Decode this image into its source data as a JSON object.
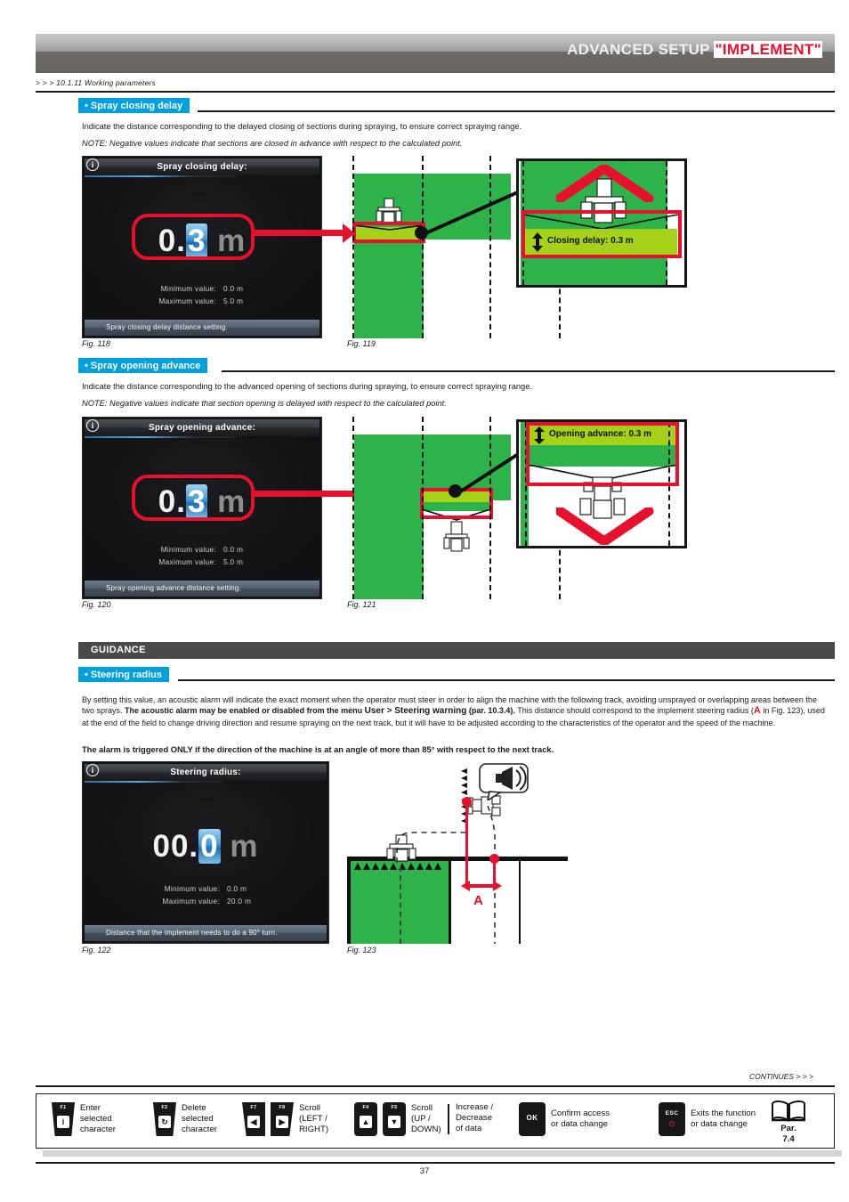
{
  "header": {
    "title_main": "ADVANCED SETUP ",
    "title_highlight": "\"IMPLEMENT\"",
    "breadcrumb": "> > > 10.1.11 Working parameters",
    "accent_blue": "#00a0df",
    "accent_red": "#e8112d",
    "band_dark": "#4a4a4a"
  },
  "sections": {
    "closing": {
      "chip": "• Spray closing delay",
      "paragraph": "Indicate the distance corresponding to the delayed closing of sections during spraying, to ensure correct spraying range.",
      "note": "NOTE: Negative values indicate that sections are closed in advance with respect to the calculated point.",
      "screen": {
        "title": "Spray closing delay:",
        "value_prefix": "0.",
        "value_selected": "3",
        "value_unit": "m",
        "min_label": "Minimum value:",
        "min_value": "0.0 m",
        "max_label": "Maximum value:",
        "max_value": "5.0 m",
        "info": "Spray closing delay distance setting.",
        "info_icon": "info-icon"
      },
      "fig_screen": "Fig. 118",
      "fig_diagram": "Fig. 119",
      "callout": "Closing delay: 0.3 m"
    },
    "opening": {
      "chip": "• Spray opening advance",
      "paragraph": "Indicate the distance corresponding to the advanced opening of sections during spraying, to ensure correct spraying range.",
      "note": "NOTE: Negative values indicate that section opening is delayed with respect to the calculated point.",
      "screen": {
        "title": "Spray opening advance:",
        "value_prefix": "0.",
        "value_selected": "3",
        "value_unit": "m",
        "min_label": "Minimum value:",
        "min_value": "0.0 m",
        "max_label": "Maximum value:",
        "max_value": "5.0 m",
        "info": "Spray opening advance distance setting.",
        "info_icon": "info-icon"
      },
      "fig_screen": "Fig. 120",
      "fig_diagram": "Fig. 121",
      "callout": "Opening advance: 0.3 m"
    },
    "guidance": {
      "band": "GUIDANCE",
      "chip": "• Steering radius",
      "para_1": "By setting this value, an acoustic alarm will indicate the exact moment when the operator must steer in order to align the machine with the following track, avoiding unsprayed or overlapping areas between the two sprays. ",
      "para_1_bold": "The acoustic alarm may be enabled or disabled from the menu ",
      "para_1_big": "User > Steering warning",
      "para_1_tail": " (par. 10.3.4).",
      "para_2_a": "This distance should correspond to the implement steering radius (",
      "para_2_A": "A",
      "para_2_b": " in Fig. 123), used at the end of the field to change driving direction and resume spraying on the next track, but it will have to be adjusted according to the characteristics of the operator and the speed of the machine.",
      "warning": "The alarm is triggered ONLY if the direction of the machine is at an angle of more than 85° with respect to the next track.",
      "screen": {
        "title": "Steering radius:",
        "value_prefix": "00.",
        "value_selected": "0",
        "value_unit": "m",
        "min_label": "Minimum value:",
        "min_value": "0.0 m",
        "max_label": "Maximum value:",
        "max_value": "20.0 m",
        "info": "Distance that the implement needs to do a 90° turn.",
        "info_icon": "info-icon"
      },
      "fig_screen": "Fig. 122",
      "fig_diagram": "Fig. 123",
      "label_A": "A",
      "horn_icon": "horn-alarm-icon"
    }
  },
  "footer": {
    "continues": "CONTINUES > > >",
    "page_number": "37",
    "legend": [
      {
        "keys": [
          "F1"
        ],
        "glyphs": [
          "i"
        ],
        "label": "Enter\nselected\ncharacter",
        "name": "key-f1-enter"
      },
      {
        "keys": [
          "F2"
        ],
        "glyphs": [
          "↻"
        ],
        "label": "Delete\nselected\ncharacter",
        "name": "key-f2-delete"
      },
      {
        "keys": [
          "F7",
          "F8"
        ],
        "glyphs": [
          "◀",
          "▶"
        ],
        "label": "Scroll\n(LEFT /\nRIGHT)",
        "name": "key-f7-f8-scroll-lr"
      },
      {
        "keys": [
          "F4",
          "F5"
        ],
        "glyphs": [
          "▲",
          "▼"
        ],
        "label": "Scroll\n(UP /\nDOWN)",
        "name": "key-f4-f5-scroll-ud"
      },
      {
        "keys": [],
        "glyphs": [],
        "label": "Increase /\nDecrease\nof data",
        "name": "legend-increase-decrease"
      },
      {
        "keys": [
          "OK"
        ],
        "glyphs": [],
        "label": "Confirm access\nor data change",
        "name": "key-ok-confirm"
      },
      {
        "keys": [
          "ESC"
        ],
        "glyphs": [
          "⏻"
        ],
        "label": "Exits the function\nor data change",
        "name": "key-esc-exit"
      }
    ],
    "par_ref": "Par.\n7.4",
    "book_icon": "open-book-icon"
  }
}
